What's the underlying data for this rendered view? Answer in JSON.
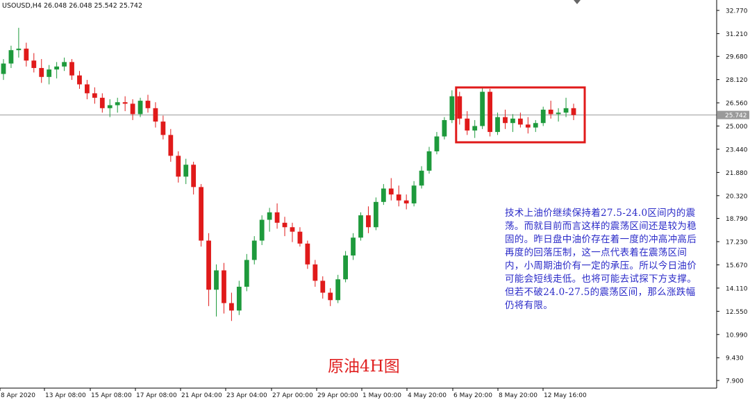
{
  "title_bar": "USOUSD,H4  26.048 26.048 25.542 25.742",
  "current_price_label": "25.742",
  "caption": "原油4H图",
  "annotation": "技术上油价继续保持着27.5-24.0区间内的震荡。而就目前而言这样的震荡区间还是较为稳固的。昨日盘中油价存在着一度的冲高冲高后再度的回落压制，这一点代表着在震荡区间内，小周期油价有一定的承压。所以今日油价可能会短线走低。也将可能去试探下方支撑。但若不破24.0-27.5的震荡区间，那么涨跌幅仍将有限。",
  "colors": {
    "bull": "#1e9a3c",
    "bear": "#e01a1a",
    "box": "#e01a1a",
    "price_line": "#9a9a9a",
    "axis": "#000000"
  },
  "chart_data": {
    "type": "candlestick",
    "symbol": "USOUSD",
    "timeframe": "H4",
    "ylim": [
      7.0,
      33.5
    ],
    "y_ticks": [
      "32.770",
      "31.210",
      "29.680",
      "28.120",
      "26.560",
      "25.000",
      "23.440",
      "21.880",
      "20.320",
      "18.790",
      "17.230",
      "15.670",
      "14.110",
      "12.550",
      "10.990",
      "9.430",
      "7.900"
    ],
    "x_ticks": [
      "8 Apr 2020",
      "13 Apr 08:00",
      "15 Apr 08:00",
      "17 Apr 08:00",
      "21 Apr 04:00",
      "23 Apr 04:00",
      "27 Apr 00:00",
      "29 Apr 00:00",
      "1 May 00:00",
      "4 May 20:00",
      "6 May 20:00",
      "8 May 20:00",
      "12 May 16:00"
    ],
    "last_price": 25.742,
    "range_box": {
      "low": 24.0,
      "high": 27.5
    },
    "candles": [
      [
        28.5,
        29.5,
        28.1,
        29.2
      ],
      [
        29.2,
        30.4,
        28.9,
        30.1
      ],
      [
        30.1,
        31.6,
        29.6,
        30.2
      ],
      [
        30.2,
        30.6,
        29.0,
        29.4
      ],
      [
        29.4,
        29.9,
        28.6,
        28.9
      ],
      [
        28.9,
        29.5,
        27.9,
        28.3
      ],
      [
        28.3,
        29.1,
        27.8,
        28.8
      ],
      [
        28.8,
        29.3,
        28.2,
        29.0
      ],
      [
        29.0,
        29.6,
        28.7,
        29.3
      ],
      [
        29.3,
        29.5,
        28.1,
        28.4
      ],
      [
        28.4,
        28.7,
        27.5,
        27.8
      ],
      [
        27.8,
        28.1,
        26.8,
        27.2
      ],
      [
        27.2,
        27.6,
        26.5,
        26.9
      ],
      [
        26.9,
        27.2,
        25.9,
        26.2
      ],
      [
        26.2,
        26.8,
        25.6,
        26.4
      ],
      [
        26.4,
        26.9,
        25.9,
        26.6
      ],
      [
        26.6,
        27.0,
        26.0,
        26.5
      ],
      [
        26.5,
        26.8,
        25.4,
        25.8
      ],
      [
        25.8,
        26.9,
        25.6,
        26.7
      ],
      [
        26.7,
        27.1,
        25.9,
        26.2
      ],
      [
        26.2,
        26.6,
        24.9,
        25.3
      ],
      [
        25.3,
        25.7,
        24.1,
        24.4
      ],
      [
        24.4,
        24.8,
        22.6,
        23.0
      ],
      [
        23.0,
        23.3,
        21.2,
        21.6
      ],
      [
        21.6,
        22.8,
        21.1,
        22.4
      ],
      [
        22.4,
        22.6,
        20.4,
        20.9
      ],
      [
        20.9,
        21.1,
        16.9,
        17.3
      ],
      [
        17.3,
        17.8,
        12.9,
        14.0
      ],
      [
        14.0,
        15.7,
        12.2,
        15.3
      ],
      [
        15.3,
        15.8,
        12.4,
        13.1
      ],
      [
        13.1,
        13.8,
        11.9,
        12.6
      ],
      [
        12.6,
        14.6,
        12.3,
        14.2
      ],
      [
        14.2,
        16.4,
        13.9,
        16.0
      ],
      [
        16.0,
        17.6,
        15.7,
        17.3
      ],
      [
        17.3,
        19.0,
        17.0,
        18.7
      ],
      [
        18.7,
        19.5,
        17.9,
        19.2
      ],
      [
        19.2,
        19.8,
        18.1,
        18.5
      ],
      [
        18.5,
        18.9,
        17.6,
        18.2
      ],
      [
        18.2,
        18.5,
        17.2,
        17.9
      ],
      [
        17.9,
        18.2,
        16.9,
        17.1
      ],
      [
        17.1,
        17.3,
        15.4,
        15.7
      ],
      [
        15.7,
        16.0,
        14.2,
        14.6
      ],
      [
        14.6,
        14.9,
        13.4,
        13.8
      ],
      [
        13.8,
        14.1,
        12.9,
        13.3
      ],
      [
        13.3,
        15.0,
        13.1,
        14.7
      ],
      [
        14.7,
        16.6,
        14.5,
        16.3
      ],
      [
        16.3,
        17.8,
        16.0,
        17.5
      ],
      [
        17.5,
        19.2,
        17.3,
        19.0
      ],
      [
        19.0,
        19.6,
        17.8,
        18.2
      ],
      [
        18.2,
        20.2,
        18.0,
        19.9
      ],
      [
        19.9,
        21.1,
        19.7,
        20.8
      ],
      [
        20.8,
        21.5,
        20.0,
        20.4
      ],
      [
        20.4,
        21.0,
        19.6,
        20.0
      ],
      [
        20.0,
        20.4,
        19.4,
        19.8
      ],
      [
        19.8,
        21.3,
        19.6,
        21.0
      ],
      [
        21.0,
        22.3,
        20.8,
        22.0
      ],
      [
        22.0,
        23.6,
        21.8,
        23.3
      ],
      [
        23.3,
        24.6,
        23.1,
        24.3
      ],
      [
        24.3,
        25.6,
        24.1,
        25.4
      ],
      [
        25.4,
        27.4,
        25.2,
        27.0
      ],
      [
        27.0,
        27.3,
        25.1,
        25.5
      ],
      [
        25.5,
        26.0,
        24.4,
        24.7
      ],
      [
        24.7,
        25.4,
        24.2,
        25.0
      ],
      [
        25.0,
        27.6,
        24.8,
        27.3
      ],
      [
        27.3,
        27.5,
        24.3,
        24.6
      ],
      [
        24.6,
        25.9,
        24.4,
        25.6
      ],
      [
        25.6,
        26.1,
        24.8,
        25.2
      ],
      [
        25.2,
        25.8,
        24.6,
        25.5
      ],
      [
        25.5,
        25.9,
        24.9,
        25.1
      ],
      [
        25.1,
        25.6,
        24.5,
        24.9
      ],
      [
        24.9,
        25.4,
        24.6,
        25.2
      ],
      [
        25.2,
        26.3,
        25.0,
        26.1
      ],
      [
        26.1,
        26.7,
        25.5,
        25.8
      ],
      [
        25.8,
        26.2,
        25.3,
        25.9
      ],
      [
        25.9,
        26.9,
        25.6,
        26.2
      ],
      [
        26.2,
        26.5,
        25.4,
        25.742
      ]
    ]
  }
}
